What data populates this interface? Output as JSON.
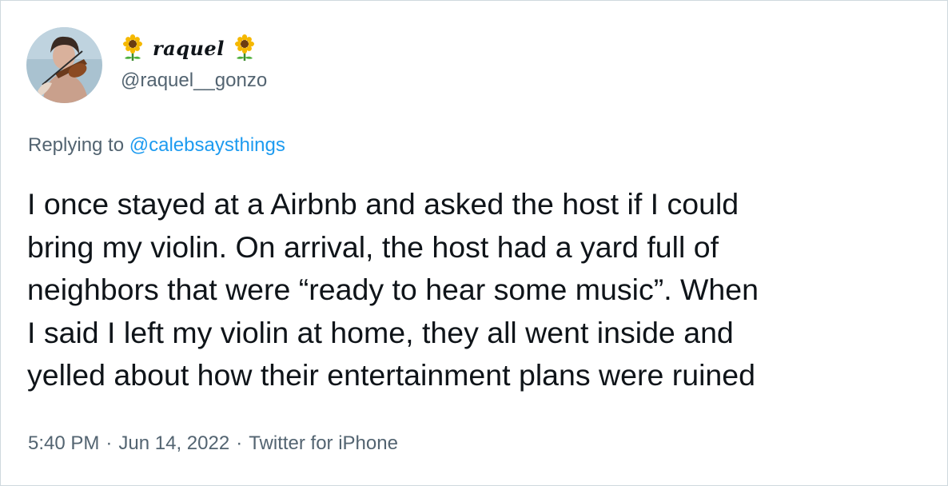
{
  "tweet": {
    "display_name": "raquel",
    "name_emoji": "sunflower-icon",
    "handle": "@raquel__gonzo",
    "avatar": "violinist-avatar",
    "reply_prefix": "Replying to",
    "reply_mention": "@calebsaysthings",
    "text_lines": [
      "I once stayed at a Airbnb and asked the host if I could",
      "bring my violin. On arrival, the host had a yard full of",
      "neighbors that were “ready to hear some music”. When",
      "I said I left my violin at home, they all went inside and",
      "yelled about how their entertainment plans were ruined"
    ],
    "time": "5:40 PM",
    "date": "Jun 14, 2022",
    "source": "Twitter for iPhone",
    "separator": "·"
  },
  "colors": {
    "text": "#0f1419",
    "secondary": "#536471",
    "link": "#1d9bf0",
    "border": "#cfd9de"
  }
}
